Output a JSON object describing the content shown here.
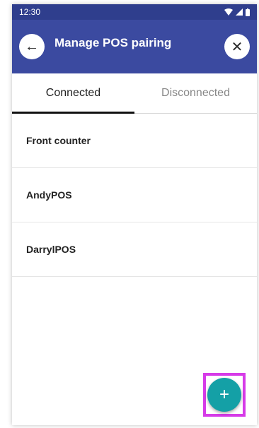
{
  "status": {
    "time": "12:30",
    "icons": [
      "wifi-icon",
      "signal-icon",
      "battery-icon"
    ]
  },
  "header": {
    "title": "Manage POS pairing",
    "back_icon": "back-arrow-icon",
    "close_icon": "close-icon"
  },
  "tabs": [
    {
      "label": "Connected",
      "active": true
    },
    {
      "label": "Disconnected",
      "active": false
    }
  ],
  "list": [
    {
      "name": "Front counter"
    },
    {
      "name": "AndyPOS"
    },
    {
      "name": "DarrylPOS"
    }
  ],
  "fab": {
    "label": "+"
  },
  "colors": {
    "appbar": "#3b4aa0",
    "statusbar": "#2f3e8d",
    "fab": "#14a0a6",
    "highlight": "#d63be8"
  }
}
